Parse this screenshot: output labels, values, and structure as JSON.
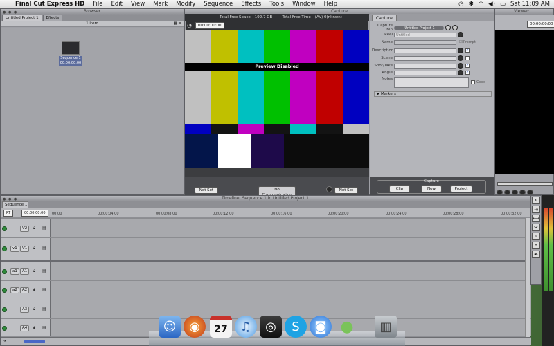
{
  "menubar": {
    "app": "Final Cut Express HD",
    "items": [
      "File",
      "Edit",
      "View",
      "Mark",
      "Modify",
      "Sequence",
      "Effects",
      "Tools",
      "Window",
      "Help"
    ],
    "clock": "Sat 11:09 AM"
  },
  "browser": {
    "title": "Browser",
    "tabs": [
      "Untitled Project 1",
      "Effects"
    ],
    "item_count": "1 item",
    "sequence_name": "Sequence 1",
    "sequence_tc": "00:00:00:00"
  },
  "capture": {
    "title": "Capture",
    "total_free_space_label": "Total Free Space",
    "total_free_space": "192.7 GB",
    "total_free_time_label": "Total Free Time",
    "total_free_time": "(AV) 0(nknwn)",
    "timecode": "00:00:00:00",
    "preview_text": "Preview Disabled",
    "in_point": "Not Set",
    "out_point": "Not Set",
    "device_status": "No Communication"
  },
  "capture_panel": {
    "tab": "Capture",
    "fields": {
      "capture_bin_label": "Capture Bin",
      "capture_bin_value": "Untitled Project 1",
      "reel_label": "Reel",
      "reel_value": "Untitled",
      "name_label": "Name",
      "prompt_label": "Prompt",
      "description_label": "Description",
      "scene_label": "Scene",
      "shot_take_label": "Shot/Take",
      "angle_label": "Angle",
      "notes_label": "Notes",
      "good_label": "Good",
      "markers_label": "Markers"
    },
    "capture_label": "Capture",
    "buttons": [
      "Clip",
      "Now",
      "Project"
    ]
  },
  "viewer": {
    "title": "Viewer: ...",
    "timecode": "00:00:00:00"
  },
  "timeline": {
    "title": "Timeline: Sequence 1 in Untitled Project 1",
    "sequence_tab": "Sequence 1",
    "rt_label": "RT",
    "current_tc": "00:00:00:00",
    "ruler": [
      "00:00",
      "00:00:04:00",
      "00:00:08:00",
      "00:00:12:00",
      "00:00:16:00",
      "00:00:20:00",
      "00:00:24:00",
      "00:00:28:00",
      "00:00:32:00"
    ],
    "tracks": [
      {
        "dest": "",
        "label": "V2"
      },
      {
        "dest": "v1",
        "label": "V1"
      },
      {
        "dest": "a1",
        "label": "A1"
      },
      {
        "dest": "a2",
        "label": "A2"
      },
      {
        "dest": "",
        "label": "A3"
      },
      {
        "dest": "",
        "label": "A4"
      }
    ]
  },
  "dock": {
    "apps": [
      "finder-icon",
      "firefox-icon",
      "ical-icon",
      "itunes-icon",
      "final-cut-icon",
      "skype-icon",
      "ichat-icon",
      "messenger-icon",
      "trash-icon"
    ],
    "ical_date": "27"
  },
  "colors": {
    "bars_top": [
      "#c0c0c0",
      "#c0c000",
      "#00c0c0",
      "#00c000",
      "#c000c0",
      "#c00000",
      "#0000c0"
    ],
    "bars_mid": [
      "#0000c0",
      "#131313",
      "#c000c0",
      "#131313",
      "#00c0c0",
      "#131313",
      "#c0c0c0"
    ]
  }
}
